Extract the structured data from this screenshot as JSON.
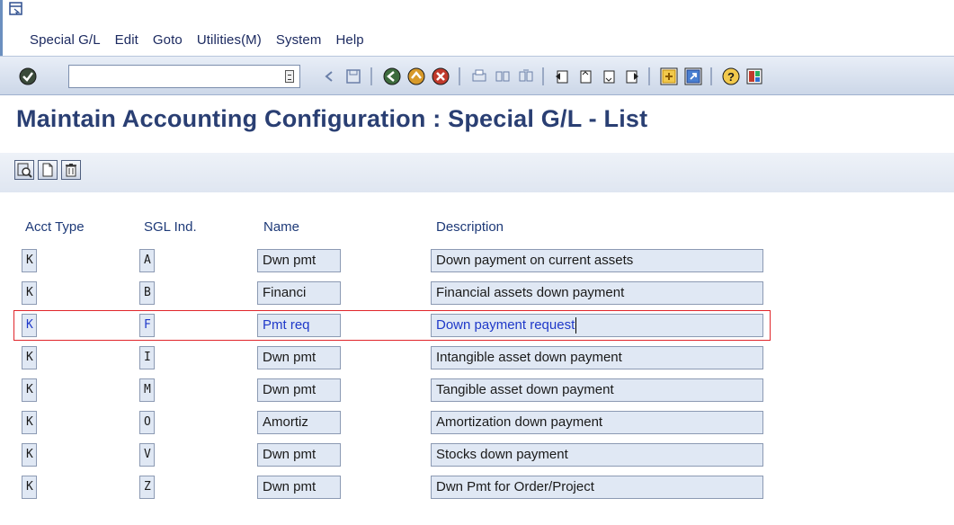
{
  "menu": {
    "items": [
      "Special G/L",
      "Edit",
      "Goto",
      "Utilities(M)",
      "System",
      "Help"
    ]
  },
  "toolbar": {
    "command_value": "",
    "icons": [
      "check-icon",
      "back-icon",
      "save-icon",
      "green-back-icon",
      "exit-icon",
      "cancel-icon",
      "print-icon",
      "find-icon",
      "find-next-icon",
      "first-page-icon",
      "prev-page-icon",
      "next-page-icon",
      "last-page-icon",
      "new-session-icon",
      "shortcut-icon",
      "help-icon",
      "layout-icon"
    ]
  },
  "title": "Maintain Accounting Configuration : Special G/L - List",
  "app_toolbar": {
    "icons": [
      "details-icon",
      "create-icon",
      "delete-icon"
    ]
  },
  "table": {
    "headers": {
      "acct_type": "Acct Type",
      "sgl_ind": "SGL Ind.",
      "name": "Name",
      "description": "Description"
    },
    "rows": [
      {
        "acct_type": "K",
        "sgl_ind": "A",
        "name": "Dwn pmt",
        "description": "Down payment on current assets"
      },
      {
        "acct_type": "K",
        "sgl_ind": "B",
        "name": "Financi",
        "description": "Financial assets down payment"
      },
      {
        "acct_type": "K",
        "sgl_ind": "F",
        "name": "Pmt req",
        "description": "Down payment request"
      },
      {
        "acct_type": "K",
        "sgl_ind": "I",
        "name": "Dwn pmt",
        "description": "Intangible asset down payment"
      },
      {
        "acct_type": "K",
        "sgl_ind": "M",
        "name": "Dwn pmt",
        "description": "Tangible asset down payment"
      },
      {
        "acct_type": "K",
        "sgl_ind": "O",
        "name": "Amortiz",
        "description": "Amortization down payment"
      },
      {
        "acct_type": "K",
        "sgl_ind": "V",
        "name": "Dwn pmt",
        "description": "Stocks down payment"
      },
      {
        "acct_type": "K",
        "sgl_ind": "Z",
        "name": "Dwn pmt",
        "description": "Dwn Pmt for Order/Project"
      }
    ],
    "selected_row": 2
  },
  "colors": {
    "title": "#2a3f73",
    "selection_frame": "#e0262b",
    "selected_text": "#1f39c9",
    "field_bg": "#e0e8f4"
  }
}
